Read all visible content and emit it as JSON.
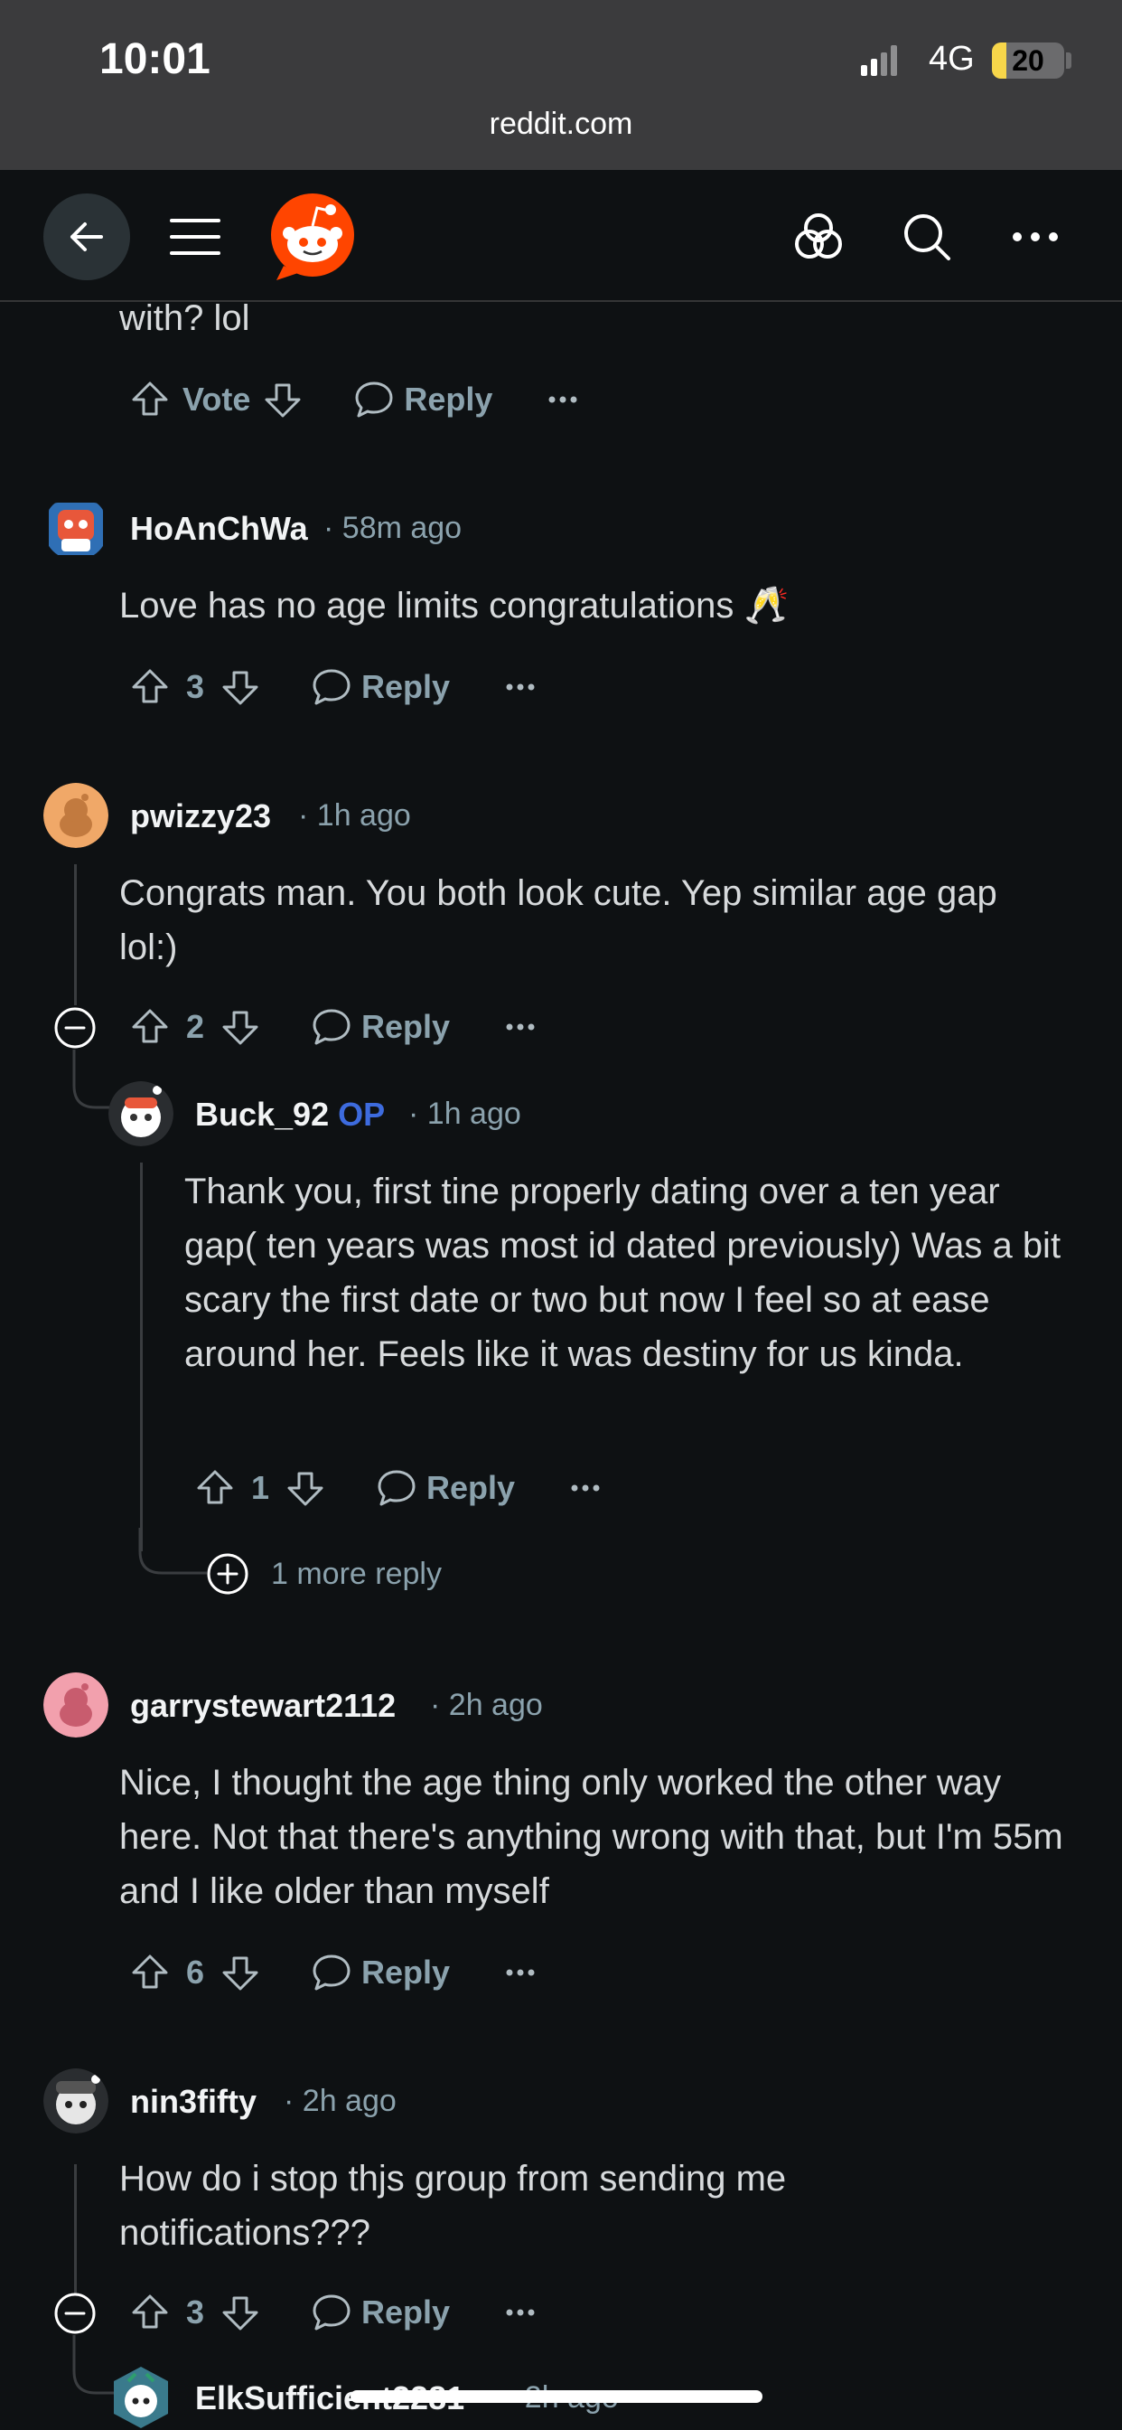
{
  "status_bar": {
    "time": "10:01",
    "network": "4G",
    "battery": "20",
    "battery_level": 0.2
  },
  "browser": {
    "url": "reddit.com"
  },
  "comments": [
    {
      "body": "with? lol",
      "vote_label": "Vote",
      "reply_label": "Reply"
    },
    {
      "user": "HoAnChWa",
      "time": "58m ago",
      "body": "Love has no age limits congratulations 🥂",
      "votes": "3",
      "reply_label": "Reply"
    },
    {
      "user": "pwizzy23",
      "time": "1h ago",
      "body": "Congrats man. You both look cute. Yep similar age gap lol:)",
      "votes": "2",
      "reply_label": "Reply"
    },
    {
      "user": "Buck_92",
      "op": "OP",
      "time": "1h ago",
      "body": "Thank you, first tine properly dating over a ten year gap( ten years was most id dated previously) Was a bit scary the first date or two but now I feel so at ease around her. Feels like it was destiny for us kinda.",
      "votes": "1",
      "reply_label": "Reply",
      "more_replies": "1 more reply"
    },
    {
      "user": "garrystewart2112",
      "time": "2h ago",
      "body": "Nice, I thought the age thing only worked the other way here. Not that there's anything wrong with that, but I'm 55m and I like older than myself",
      "votes": "6",
      "reply_label": "Reply"
    },
    {
      "user": "nin3fifty",
      "time": "2h ago",
      "body": "How do i stop thjs group from sending me notifications???",
      "votes": "3",
      "reply_label": "Reply"
    },
    {
      "user": "ElkSufficient2281",
      "time": "2h ago"
    }
  ],
  "colors": {
    "background": "#0e1113",
    "accent_op": "#3d6bde",
    "reddit_orange": "#ff4500"
  }
}
